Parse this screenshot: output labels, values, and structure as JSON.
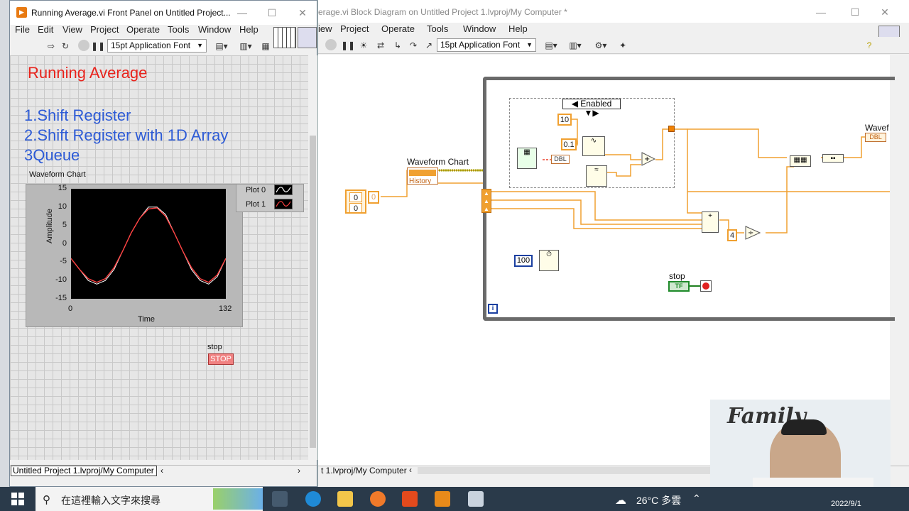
{
  "front_panel": {
    "window_title": "Running Average.vi Front Panel on Untitled Project...",
    "menu": [
      "File",
      "Edit",
      "View",
      "Project",
      "Operate",
      "Tools",
      "Window",
      "Help"
    ],
    "font_selector": "15pt Application Font",
    "heading": "Running Average",
    "items": [
      "1.Shift Register",
      "2.Shift Register with 1D Array",
      "3Queue"
    ],
    "chart": {
      "label": "Waveform Chart",
      "legend": [
        "Plot 0",
        "Plot 1"
      ]
    },
    "stop_label": "stop",
    "stop_button": "STOP",
    "status_path": "Untitled Project 1.lvproj/My Computer"
  },
  "block_diagram": {
    "window_title": "erage.vi Block Diagram on Untitled Project 1.lvproj/My Computer *",
    "menu": [
      "iew",
      "Project",
      "Operate",
      "Tools",
      "Window",
      "Help"
    ],
    "font_selector": "15pt Application Font",
    "chart_label": "Waveform Chart",
    "chart_history": "History",
    "wavef_label": "Wavef",
    "dbl_tag": "DBL",
    "enabled": "Enabled",
    "const_10": "10",
    "const_01": "0.1",
    "const_100": "100",
    "const_4": "4",
    "const_zero_a": "0",
    "const_zero_b": "0",
    "const_zero_c": "0",
    "stop_label": "stop",
    "tf_tag": "TF",
    "loop_i": "i",
    "status_path": "t 1.lvproj/My Computer"
  },
  "chart_data": {
    "type": "line",
    "title": "",
    "xlabel": "Time",
    "ylabel": "Amplitude",
    "xlim": [
      0,
      132
    ],
    "ylim": [
      -15,
      15
    ],
    "x_ticks": [
      "0",
      "132"
    ],
    "y_ticks": [
      "15",
      "10",
      "5",
      "0",
      "-5",
      "-10",
      "-15"
    ],
    "series": [
      {
        "name": "Plot 0",
        "color": "#ffffff",
        "values": [
          -4,
          -7,
          -10,
          -11,
          -10,
          -7,
          -2,
          3,
          7,
          10,
          10,
          8,
          3,
          -2,
          -7,
          -10,
          -11,
          -9,
          -4
        ]
      },
      {
        "name": "Plot 1",
        "color": "#ff4040",
        "values": [
          -4,
          -7,
          -9.5,
          -10.5,
          -9.5,
          -6.5,
          -2,
          3,
          7,
          9.5,
          9.8,
          7.5,
          3,
          -2,
          -6.5,
          -9.5,
          -10.5,
          -8.5,
          -4
        ]
      }
    ]
  },
  "taskbar": {
    "search_placeholder": "在這裡輸入文字來搜尋",
    "weather": "26°C 多雲",
    "date": "2022/9/1"
  },
  "webcam": {
    "sign_text": "Family"
  },
  "colors": {
    "heading_red": "#e8231c",
    "item_blue": "#2d5bd6",
    "wire_orange": "#f0a030",
    "loop_gray": "#6a6a6a"
  }
}
